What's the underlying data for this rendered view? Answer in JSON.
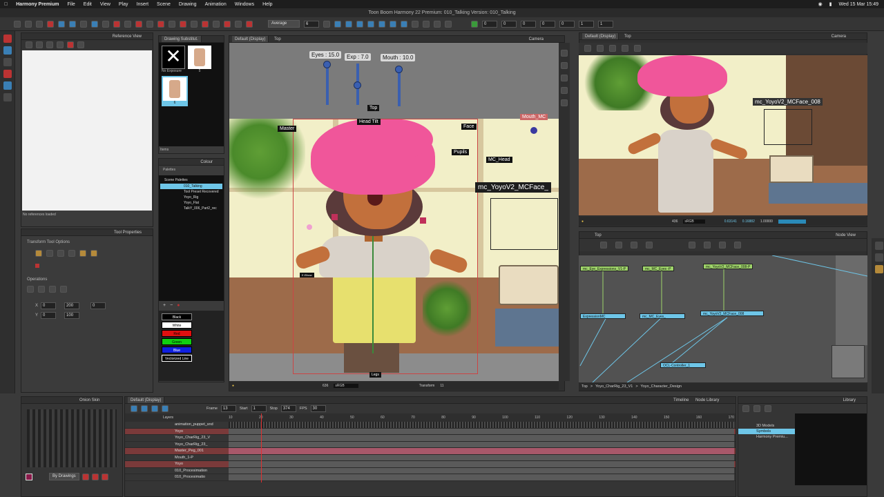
{
  "menubar": {
    "app": "Harmony Premium",
    "items": [
      "File",
      "Edit",
      "View",
      "Play",
      "Insert",
      "Scene",
      "Drawing",
      "Animation",
      "Windows",
      "Help"
    ],
    "datetime": "Wed 15 Mar 15:49"
  },
  "window_title": "Toon Boom Harmony 22 Premium: 010_Talking Version: 010_Talking",
  "toolbar": {
    "blend_mode": "Average",
    "value": "6",
    "fields": [
      "0",
      "0",
      "0",
      "0",
      "0",
      "1",
      "1"
    ]
  },
  "reference_view": {
    "title": "Reference View",
    "status": "No references loaded"
  },
  "drawing_substitution": {
    "title": "Drawing Substitut.",
    "items": [
      {
        "label": "No Exposure"
      },
      {
        "label": "5"
      },
      {
        "label": "6"
      }
    ],
    "footer": "Items"
  },
  "colour": {
    "title": "Colour",
    "palettes_label": "Palettes",
    "scene_palettes_label": "Scene Palettes",
    "palettes": [
      "010_Talking",
      "Tool Preset Recovered",
      "Yoyo_Rig",
      "Yoyo_Flat",
      "TalkY_006_Part2_rec"
    ],
    "swatches": [
      {
        "label": "Black",
        "color": "#000000",
        "text": "#ffffff"
      },
      {
        "label": "White",
        "color": "#ffffff",
        "text": "#000000"
      },
      {
        "label": "Red",
        "color": "#e01010",
        "text": "#000000"
      },
      {
        "label": "Green",
        "color": "#10d010",
        "text": "#000000"
      },
      {
        "label": "Blue",
        "color": "#1020e0",
        "text": "#ffffff"
      },
      {
        "label": "Vectorized Line",
        "color": "#000000",
        "text": "#ffffff"
      }
    ]
  },
  "tool_properties": {
    "title": "Tool Properties",
    "transform_label": "Transform Tool Options",
    "operations_label": "Operations",
    "x_label": "X",
    "y_label": "Y",
    "x_val": "0",
    "y_val": "0",
    "w_val": "200",
    "h_val": "100",
    "angle_val": "0"
  },
  "stage": {
    "tab": "Default (Display)",
    "top_label": "Top",
    "camera_label": "Camera",
    "sliders": [
      {
        "label": "Eyes : 15.0"
      },
      {
        "label": "Exp : 7.0"
      },
      {
        "label": "Mouth : 10.0"
      }
    ],
    "tags": {
      "top": "Top",
      "head_tilt": "Head Tilt",
      "master": "Master",
      "face": "Face",
      "pupils": "Pupils",
      "mc_head": "MC_Head",
      "mc_face": "mc_YoyoV2_MCFace_",
      "mouth_mc": "Mouth_MC",
      "elbow": "E.Elbow",
      "legs": "Legs"
    },
    "status": {
      "zoom": "636",
      "color_space": "sRGB",
      "frame": "11",
      "transform": "Transform"
    }
  },
  "camera_view": {
    "tab": "Default (Display)",
    "top_label": "Top",
    "camera_label": "Camera",
    "tag": "mc_YoyoV2_MCFace_008",
    "status": {
      "zoom": "436",
      "color_space": "sRGB",
      "value1": "0.63141",
      "value2": "0.16882",
      "value3": "1.00000"
    }
  },
  "node_view": {
    "title": "Node View",
    "top_label": "Top",
    "nodes": [
      "mc_Eye_Expressions_V1-P",
      "mc_MC_Eyes -P",
      "mc_YoyoV2_MCFace_008-P",
      "ExpressionMC",
      "mc_MC_Eyes_",
      "mc_YoyoV2_MCFace_008",
      "OCL-Controller_1"
    ],
    "breadcrumb": [
      "Top",
      "Yoyo_CharRig_23_V1",
      "Yoyo_Character_Design"
    ]
  },
  "onion_skin": {
    "title": "Onion Skin",
    "mode": "By Drawings"
  },
  "timeline": {
    "tab": "Default (Display)",
    "tabs": [
      "Timeline",
      "Node Library"
    ],
    "frame_label": "Frame",
    "frame": "13",
    "start_label": "Start",
    "start": "1",
    "stop_label": "Stop",
    "stop": "374",
    "fps_label": "FPS",
    "fps": "30",
    "layers_label": "Layers",
    "ruler": [
      "10",
      "20",
      "30",
      "40",
      "50",
      "60",
      "70",
      "80",
      "90",
      "100",
      "110",
      "120",
      "130",
      "140",
      "150",
      "160",
      "170"
    ],
    "layers": [
      {
        "name": "animation_puppet_snd",
        "red": false
      },
      {
        "name": "Yoyo",
        "red": true
      },
      {
        "name": "Yoyo_CharRig_23_V",
        "red": false
      },
      {
        "name": "Yoyo_CharRig_23_",
        "red": false
      },
      {
        "name": "Master_Peg_001",
        "red": true
      },
      {
        "name": "Mouth_1-P",
        "red": false
      },
      {
        "name": "Yoyo",
        "red": true
      },
      {
        "name": "010_Procesimation",
        "red": false
      },
      {
        "name": "010_Procesimatio",
        "red": false
      }
    ]
  },
  "library": {
    "title": "Library",
    "items": [
      "3D Models",
      "Symbols",
      "Harmony Premiu..."
    ]
  },
  "colors": {
    "accent": "#6ec6e8",
    "node_green": "#9fd46a",
    "hair": "#f0569a",
    "skin": "#c2703c",
    "shirt": "#e7e06e",
    "bg_window": "#f2efc8"
  }
}
